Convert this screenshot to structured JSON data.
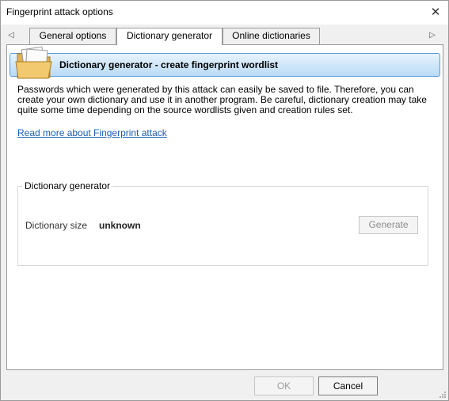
{
  "window": {
    "title": "Fingerprint attack options",
    "close_glyph": "✕"
  },
  "tabs": {
    "left_arrow": "◁",
    "right_arrow": "▷",
    "items": [
      {
        "label": "General options",
        "active": false
      },
      {
        "label": "Dictionary generator",
        "active": true
      },
      {
        "label": "Online dictionaries",
        "active": false
      }
    ]
  },
  "banner": {
    "title": "Dictionary generator - create fingerprint wordlist",
    "icon": "folder-icon"
  },
  "description": "Passwords which were generated by this attack can easily be saved to file. Therefore, you can create your own dictionary and use it in another program. Be careful, dictionary creation may take quite some time depending on the source wordlists given and creation rules set.",
  "learn_more_link": "Read more about Fingerprint attack",
  "generator": {
    "group_label": "Dictionary generator",
    "size_label": "Dictionary size",
    "size_value": "unknown",
    "generate_label": "Generate"
  },
  "footer": {
    "ok_label": "OK",
    "cancel_label": "Cancel"
  },
  "colors": {
    "banner_border": "#5a9bd8",
    "link": "#1a5fb4",
    "disabled_text": "#8d8d8d"
  }
}
